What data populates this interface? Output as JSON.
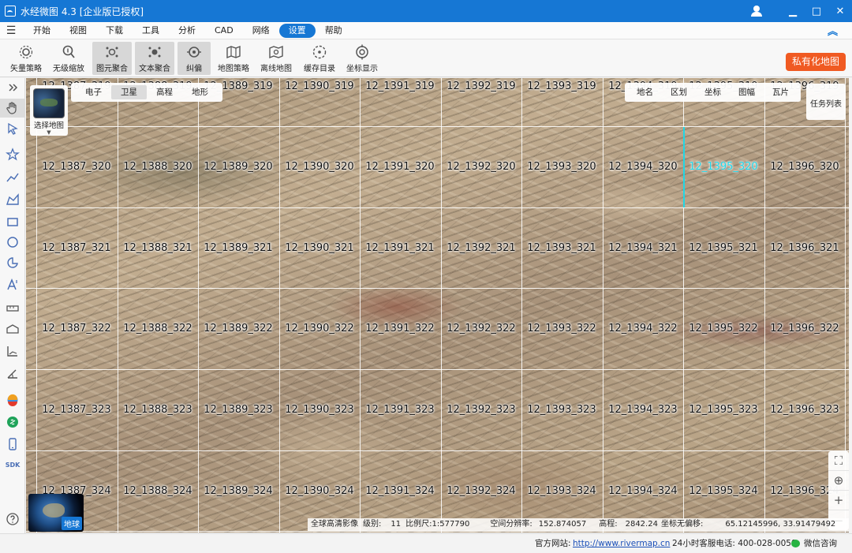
{
  "window": {
    "title": "水经微图 4.3 [企业版已授权]",
    "minimize_glyph": "▁",
    "maximize_glyph": "□",
    "close_glyph": "✕"
  },
  "menu": {
    "items": [
      "开始",
      "视图",
      "下载",
      "工具",
      "分析",
      "CAD",
      "网络",
      "设置",
      "帮助"
    ],
    "active": "设置"
  },
  "toolbar": {
    "tools": [
      {
        "label": "矢量策略",
        "icon": "gear-cluster-icon",
        "pressed": false
      },
      {
        "label": "无级缩放",
        "icon": "zoom-icon",
        "pressed": false
      },
      {
        "label": "图元聚合",
        "icon": "cluster-icon",
        "pressed": true
      },
      {
        "label": "文本聚合",
        "icon": "text-cluster-icon",
        "pressed": true
      },
      {
        "label": "纠偏",
        "icon": "correction-icon",
        "pressed": true
      },
      {
        "label": "地图策略",
        "icon": "map-strategy-icon",
        "pressed": false
      },
      {
        "label": "离线地图",
        "icon": "offline-map-icon",
        "pressed": false
      },
      {
        "label": "缓存目录",
        "icon": "cache-folder-icon",
        "pressed": false
      },
      {
        "label": "坐标显示",
        "icon": "coordinate-icon",
        "pressed": false
      }
    ],
    "brand_button": "私有化地图"
  },
  "map": {
    "source_tabs": [
      "电子",
      "卫星",
      "高程",
      "地形"
    ],
    "active_source": "卫星",
    "layer_tabs": [
      "地名",
      "区划",
      "坐标",
      "图幅",
      "瓦片"
    ],
    "task_list": "任务列表",
    "map_picker_label": "选择地图",
    "globe_label": "地球",
    "tile_columns": [
      "1387",
      "1388",
      "1389",
      "1390",
      "1391",
      "1392",
      "1393",
      "1394",
      "1395",
      "1396"
    ],
    "tile_rows": [
      "319",
      "320",
      "321",
      "322",
      "323",
      "324"
    ],
    "tile_zoom": "12",
    "selected_tile": "12_1395_320",
    "status": {
      "source": "全球高清影像",
      "level_label": "级别:",
      "level": "11",
      "scale_label": "比例尺:",
      "scale": "1:577790",
      "resolution_label": "空间分辨率:",
      "resolution": "152.874057",
      "elevation_label": "高程:",
      "elevation": "2842.24",
      "coord_label": "坐标无偏移:",
      "coords": "65.12145996, 33.91479492"
    }
  },
  "statusbar": {
    "site_label": "官方网站:",
    "site_url": "http://www.rivermap.cn",
    "hotline": "24小时客服电话: 400-028-0050",
    "wechat": "微信咨询"
  },
  "colors": {
    "title_bar": "#1677d4",
    "brand_button": "#f05a22",
    "selected_tile": "#20d8ea"
  }
}
